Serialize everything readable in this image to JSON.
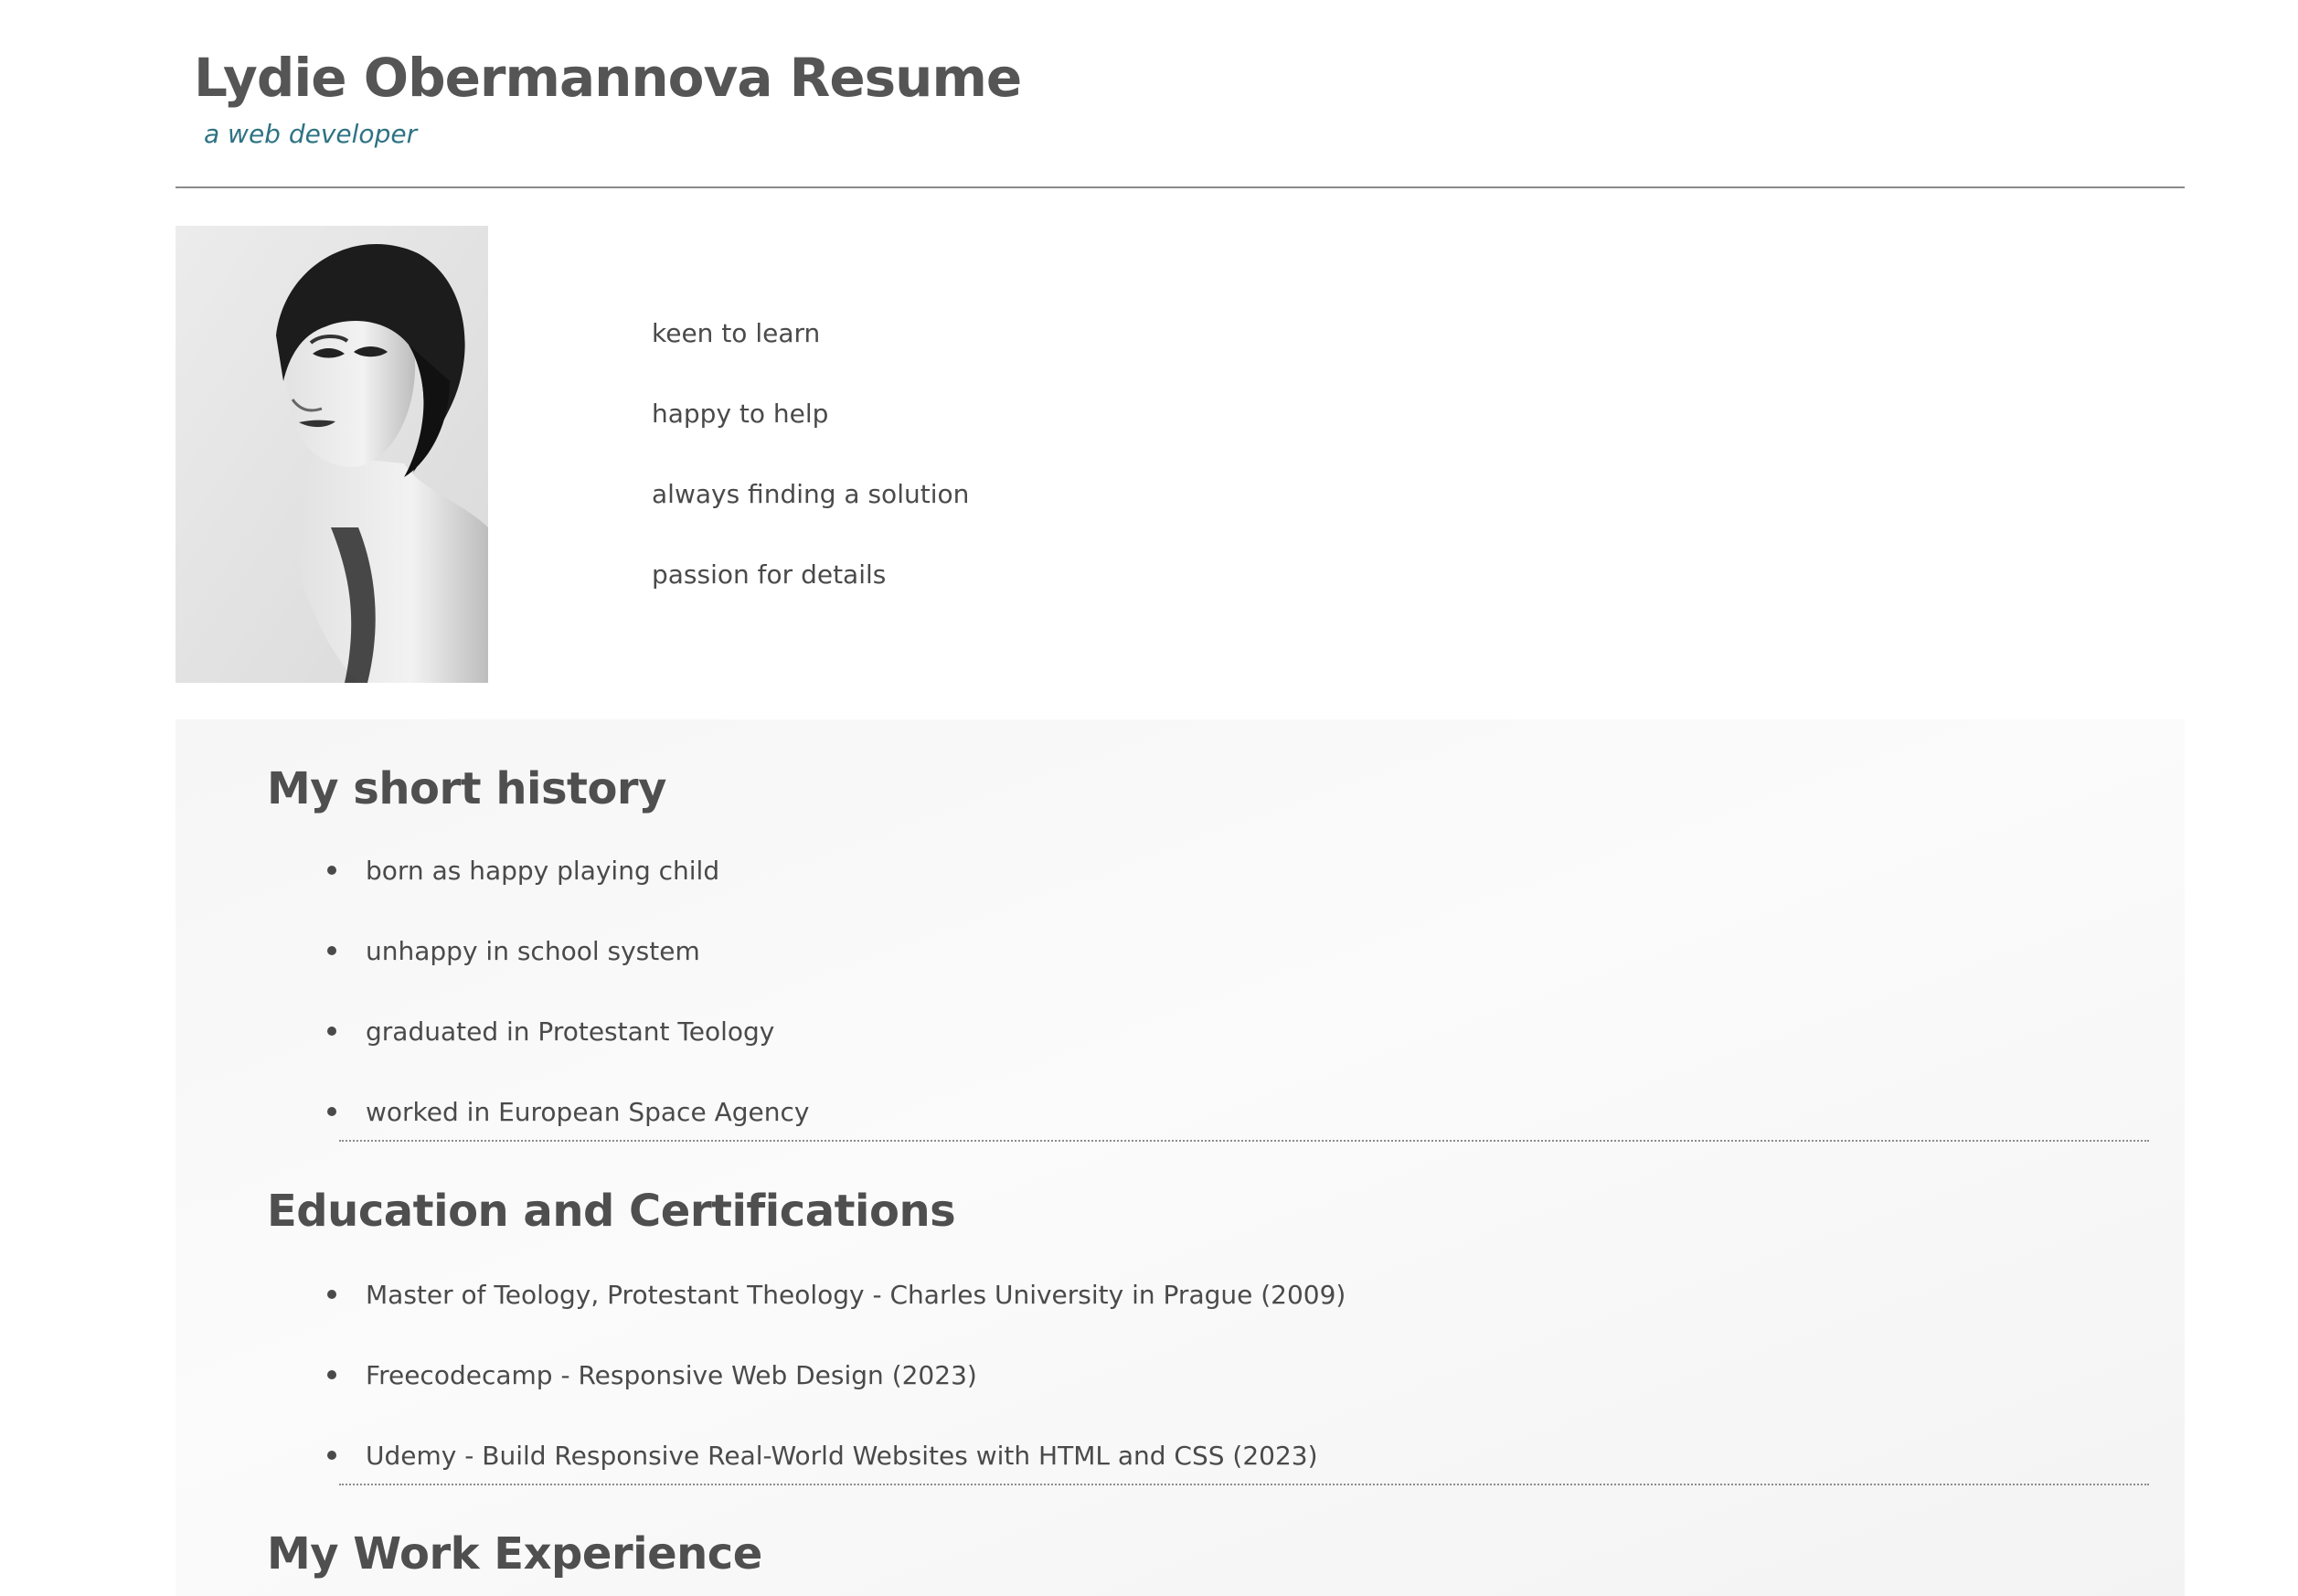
{
  "header": {
    "title": "Lydie Obermannova Resume",
    "subtitle": "a web developer"
  },
  "profile": {
    "photo_icon": "portrait-photo",
    "qualities": [
      "keen to learn",
      "happy to help",
      "always finding a solution",
      "passion for details"
    ]
  },
  "history": {
    "title": "My short history",
    "items": [
      "born as happy playing child",
      "unhappy in school system",
      "graduated in Protestant Teology",
      "worked in European Space Agency"
    ]
  },
  "education": {
    "title": "Education and Certifications",
    "items": [
      "Master of Teology, Protestant Theology - Charles University in Prague (2009)",
      "Freecodecamp - Responsive Web Design (2023)",
      "Udemy - Build Responsive Real-World Websites with HTML and CSS (2023)"
    ]
  },
  "work": {
    "title": "My Work Experience"
  },
  "colors": {
    "heading": "#555555",
    "subtitle_accent": "#2e7383",
    "panel_background": "#f7f7f7",
    "text": "#4a4a4a"
  }
}
